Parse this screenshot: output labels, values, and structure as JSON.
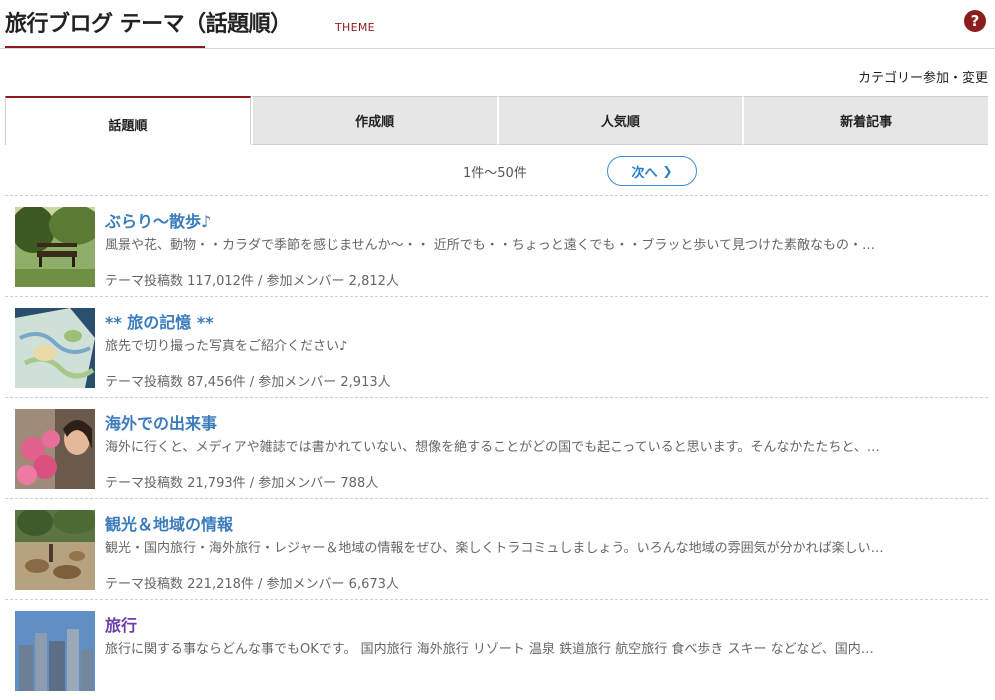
{
  "header": {
    "title": "旅行ブログ テーマ（話題順）",
    "theme_label": "THEME",
    "help_icon": "?"
  },
  "category_link": "カテゴリー参加・変更",
  "tabs": [
    {
      "label": "話題順",
      "active": true
    },
    {
      "label": "作成順",
      "active": false
    },
    {
      "label": "人気順",
      "active": false
    },
    {
      "label": "新着記事",
      "active": false
    }
  ],
  "pager": {
    "range": "1件〜50件",
    "next_label": "次へ"
  },
  "items": [
    {
      "title": "ぶらり〜散歩♪",
      "desc": "風景や花、動物・・カラダで季節を感じませんか〜・・ 近所でも・・ちょっと遠くでも・・ブラッと歩いて見つけた素敵なもの・…",
      "stats": "テーマ投稿数 117,012件 /  参加メンバー 2,812人",
      "thumb": "park-bench-photo"
    },
    {
      "title": "** 旅の記憶 **",
      "desc": "旅先で切り撮った写真をご紹介ください♪",
      "stats": "テーマ投稿数 87,456件 /  参加メンバー 2,913人",
      "thumb": "map-photo"
    },
    {
      "title": "海外での出来事",
      "desc": "海外に行くと、メディアや雑誌では書かれていない、想像を絶することがどの国でも起こっていると思います。そんなかたたちと、…",
      "stats": "テーマ投稿数 21,793件 /  参加メンバー 788人",
      "thumb": "person-photo"
    },
    {
      "title": "観光＆地域の情報",
      "desc": "観光・国内旅行・海外旅行・レジャー＆地域の情報をぜひ、楽しくトラコミュしましょう。いろんな地域の雰囲気が分かれば楽しい…",
      "stats": "テーマ投稿数 221,218件 /  参加メンバー 6,673人",
      "thumb": "deer-park-photo"
    },
    {
      "title": "旅行",
      "desc": "旅行に関する事ならどんな事でもOKです。 国内旅行 海外旅行 リゾート 温泉 鉄道旅行 航空旅行 食べ歩き スキー などなど、国内…",
      "stats": "",
      "thumb": "city-skyline-photo"
    }
  ],
  "colors": {
    "accent": "#8a1d1d",
    "link": "#3b7cbd",
    "visited": "#6a3fa8",
    "tab_bg": "#e6e6e6"
  }
}
